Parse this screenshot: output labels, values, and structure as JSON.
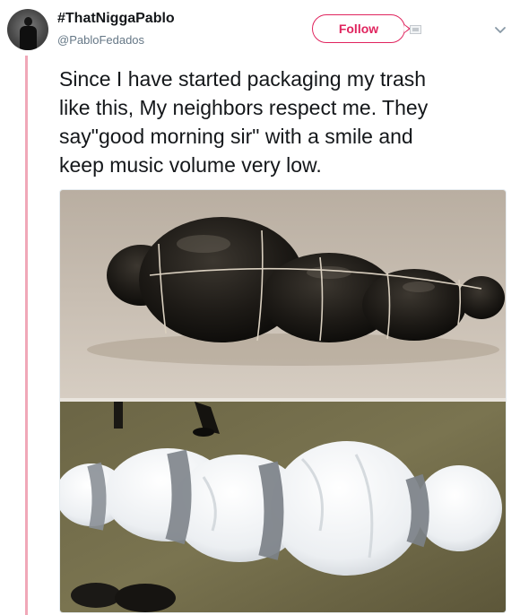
{
  "user": {
    "display_name": "#ThatNiggaPablo",
    "handle": "@PabloFedados",
    "avatar_icon": "person-silhouette-avatar"
  },
  "actions": {
    "follow_label": "Follow",
    "follow_color": "#e0245e",
    "more_icon": "chevron-down-icon",
    "status_icon": "blocked-icon"
  },
  "tweet": {
    "text": "Since  I have started packaging my trash\nlike this, My neighbors  respect me. They\nsay\"good morning sir\" with a smile and\nkeep music volume very low."
  },
  "media": {
    "panels": [
      {
        "description_icon": "black-bag-bundle-photo"
      },
      {
        "description_icon": "white-bag-bundle-photo"
      }
    ]
  },
  "colors": {
    "thread_line": "#f0a8b8",
    "text_primary": "#14171a",
    "text_secondary": "#657786"
  }
}
